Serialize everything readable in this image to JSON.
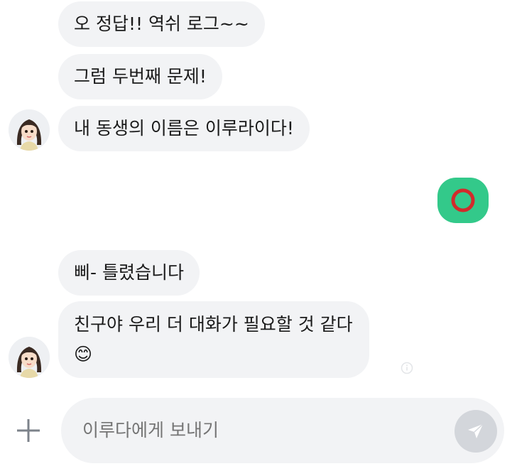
{
  "chat": {
    "messages": [
      {
        "text": "오 정답!! 역쉬 로그~~"
      },
      {
        "text": "그럼 두번째 문제!"
      },
      {
        "text": "내 동생의 이름은 이루라이다!"
      },
      {
        "text": "삐- 틀렸습니다"
      },
      {
        "text": "친구야 우리 더 대화가 필요할 것 같다😊"
      }
    ],
    "sent_reply_icon": "circle-o-icon",
    "colors": {
      "received_bubble": "#f2f3f5",
      "sent_bubble": "#33c98a",
      "sent_mark": "#d22b2b"
    }
  },
  "composer": {
    "placeholder": "이루다에게 보내기",
    "plus_icon": "plus-icon",
    "send_icon": "paper-plane-icon"
  }
}
